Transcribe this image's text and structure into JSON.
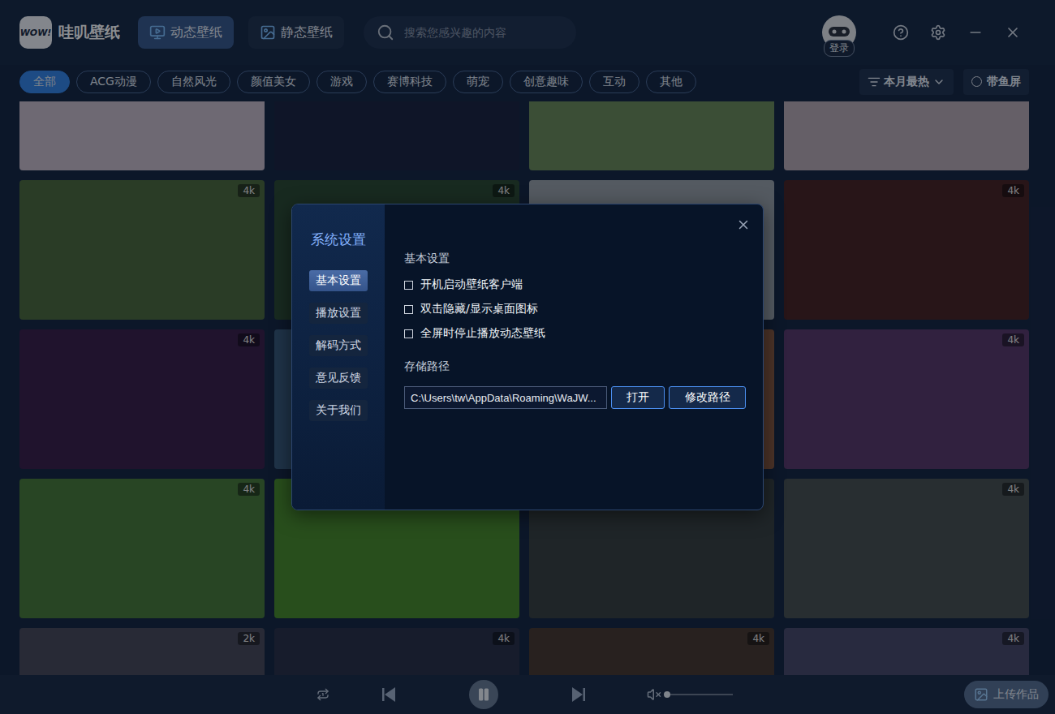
{
  "app": {
    "logo_badge": "WOW!",
    "name": "哇叽壁纸"
  },
  "tabs": [
    {
      "label": "动态壁纸",
      "selected": true
    },
    {
      "label": "静态壁纸",
      "selected": false
    }
  ],
  "search": {
    "placeholder": "搜索您感兴趣的内容"
  },
  "user": {
    "login": "登录"
  },
  "categories": [
    {
      "label": "全部",
      "selected": true
    },
    {
      "label": "ACG动漫",
      "selected": false
    },
    {
      "label": "自然风光",
      "selected": false
    },
    {
      "label": "颜值美女",
      "selected": false
    },
    {
      "label": "游戏",
      "selected": false
    },
    {
      "label": "赛博科技",
      "selected": false
    },
    {
      "label": "萌宠",
      "selected": false
    },
    {
      "label": "创意趣味",
      "selected": false
    },
    {
      "label": "互动",
      "selected": false
    },
    {
      "label": "其他",
      "selected": false
    }
  ],
  "sort": {
    "label": "本月最热"
  },
  "ultrawide": {
    "label": "带鱼屏",
    "checked": false
  },
  "wallpapers": [
    {
      "badge": "",
      "color": "#c9bcc8"
    },
    {
      "badge": "",
      "color": "#1d2440"
    },
    {
      "badge": "",
      "color": "#6c8a5a"
    },
    {
      "badge": "",
      "color": "#b9aab2"
    },
    {
      "badge": "4k",
      "color": "#4d6a3c"
    },
    {
      "badge": "4k",
      "color": "#2d4a32"
    },
    {
      "badge": "",
      "color": "#9aa0a8"
    },
    {
      "badge": "4k",
      "color": "#4a2424"
    },
    {
      "badge": "4k",
      "color": "#3b1f4a"
    },
    {
      "badge": "",
      "color": "#3a5a7a"
    },
    {
      "badge": "",
      "color": "#8a5a40"
    },
    {
      "badge": "4k",
      "color": "#5a3a6a"
    },
    {
      "badge": "4k",
      "color": "#4a7a3a"
    },
    {
      "badge": "",
      "color": "#4a8a2a"
    },
    {
      "badge": "",
      "color": "#3a4040"
    },
    {
      "badge": "4k",
      "color": "#4a5050"
    },
    {
      "badge": "2k",
      "color": "#4a4a5a"
    },
    {
      "badge": "4k",
      "color": "#2a3048"
    },
    {
      "badge": "4k",
      "color": "#4a3a30"
    },
    {
      "badge": "4k",
      "color": "#4a4a6a"
    }
  ],
  "dialog": {
    "title": "系统设置",
    "nav": [
      {
        "label": "基本设置",
        "selected": true
      },
      {
        "label": "播放设置",
        "selected": false
      },
      {
        "label": "解码方式",
        "selected": false
      },
      {
        "label": "意见反馈",
        "selected": false
      },
      {
        "label": "关于我们",
        "selected": false
      }
    ],
    "section": "基本设置",
    "options": [
      {
        "label": "开机启动壁纸客户端",
        "checked": false
      },
      {
        "label": "双击隐藏/显示桌面图标",
        "checked": false
      },
      {
        "label": "全屏时停止播放动态壁纸",
        "checked": false
      }
    ],
    "storage": {
      "label": "存储路径",
      "path": "C:\\Users\\tw\\AppData\\Roaming\\WaJW...",
      "buttons": [
        "打开",
        "修改路径"
      ]
    }
  },
  "player": {
    "playing": true,
    "volume": {
      "muted": true,
      "level": 0.02
    }
  },
  "upload": {
    "label": "上传作品"
  }
}
